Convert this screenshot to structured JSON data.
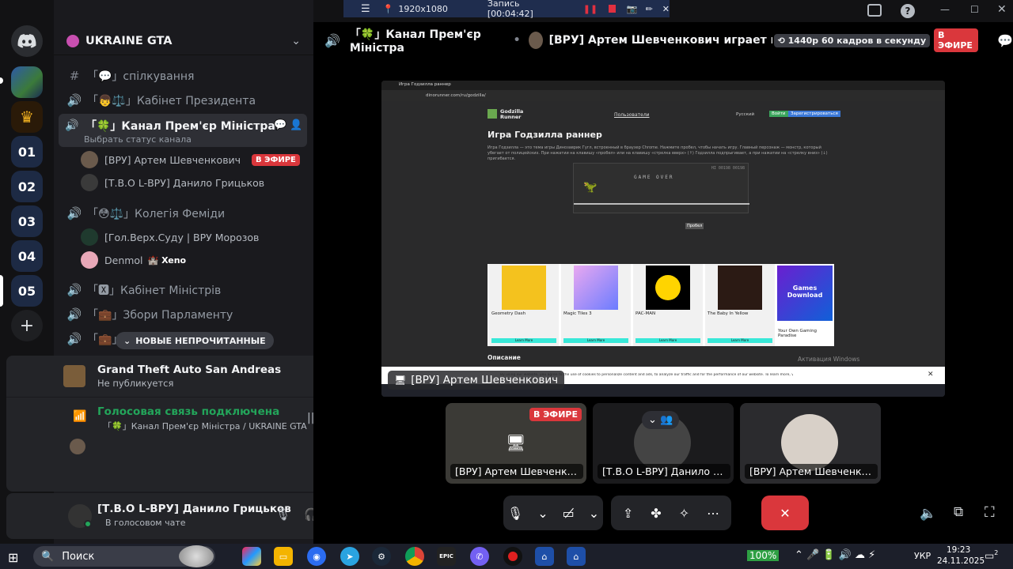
{
  "recording": {
    "resolution": "1920x1080",
    "label": "Запись [00:04:42]"
  },
  "server": {
    "name": "UKRAINE GTA"
  },
  "channels": [
    {
      "icon": "#",
      "name": "「💬」спілкування",
      "type": "text"
    },
    {
      "icon": "🔊",
      "name": "「👦⚖️」Кабінет Президента",
      "type": "voice"
    },
    {
      "icon": "🔊",
      "name": "「🍀」Канал Прем'єр Міністра",
      "type": "voice",
      "active": true,
      "status": "Выбрать статус канала"
    },
    {
      "icon": "🔊",
      "name": "「😳⚖️」Колегія Феміди",
      "type": "voice"
    },
    {
      "icon": "🔊",
      "name": "「🆇」Кабінет Міністрів",
      "type": "voice"
    },
    {
      "icon": "🔊",
      "name": "「💼」Збори Парламенту",
      "type": "voice"
    },
    {
      "icon": "🔊",
      "name": "「💼」",
      "type": "voice"
    }
  ],
  "voice_users_pm": [
    {
      "name": "[ВРУ] Артем Шевченкович",
      "badge": "В ЭФИРЕ"
    },
    {
      "name": "[Т.В.О L-ВРУ] Данило Грицьков"
    }
  ],
  "voice_users_femidy": [
    {
      "name": "[Гол.Верх.Суду | ВРУ Морозов"
    },
    {
      "name": "Denmol",
      "tag": "Xeno"
    }
  ],
  "unread_pill": "НОВЫЕ НЕПРОЧИТАННЫЕ",
  "activity": {
    "game": "Grand Theft Auto San Andreas",
    "status": "Не публикуется"
  },
  "voice_panel": {
    "title": "Голосовая связь подключена",
    "channel": "「🍀」Канал Прем'єр Міністра / UKRAINE GTA"
  },
  "user": {
    "name": "[Т.В.О L-ВРУ] Данило Грицьков",
    "status": "В голосовом чате"
  },
  "stage": {
    "channel": "「🍀」Канал Прем'єр Міністра",
    "streamer": "[ВРУ] Артем Шевченкович играет в UKRAIN",
    "quality": "1440p 60 кадров в секунду",
    "live": "В ЭФИРЕ",
    "stream_label": "[ВРУ] Артем Шевченкович"
  },
  "tiles": [
    {
      "label": "[ВРУ] Артем Шевченко...",
      "badge": "В ЭФИРЕ"
    },
    {
      "label": "[Т.В.О L-ВРУ] Данило Гри..."
    },
    {
      "label": "[ВРУ] Артем Шевченкович"
    }
  ],
  "shot": {
    "tab": "Игра Годзилла раннер",
    "url": "dinorunner.com/ru/godzilla/",
    "logo": "Godzilla Runner",
    "nav_users": "Пользователи",
    "lang": "Русский",
    "login": "Войти",
    "register": "Зарегистрироваться",
    "title": "Игра Годзилла раннер",
    "desc": "Игра Годзилла — это тема игры Динозаврик Гугл, встроенный в браузер Chrome. Нажмите пробел, чтобы начать игру. Главный персонаж — монстр, который убегает от полицейских. При нажатии на клавишу «пробел» или на клавишу «стрелка вверх» (↑) Годзилла подпрыгивает, а при нажатии на «стрелку вниз» (↓) пригибается.",
    "game_over": "GAME OVER",
    "hi": "HI 00198 00198",
    "space_btn": "Пробел",
    "cards": [
      "Geometry Dash",
      "Magic Tiles 3",
      "PAC-MAN",
      "The Baby In Yellow",
      "Your Own Gaming Paradise"
    ],
    "learn_more": "Learn More",
    "games_download": "Games Download",
    "description_heading": "Описание",
    "activation": "Активация Windows",
    "cookie": "By using our website, you agree to the use of cookies to personalize content and ads, to analyze our traffic and for the performance of our website. To learn more, visit our"
  },
  "taskbar": {
    "search": "Поиск",
    "battery": "100%",
    "lang": "УКР",
    "time": "19:23",
    "date": "24.11.2025",
    "notif": "2"
  }
}
